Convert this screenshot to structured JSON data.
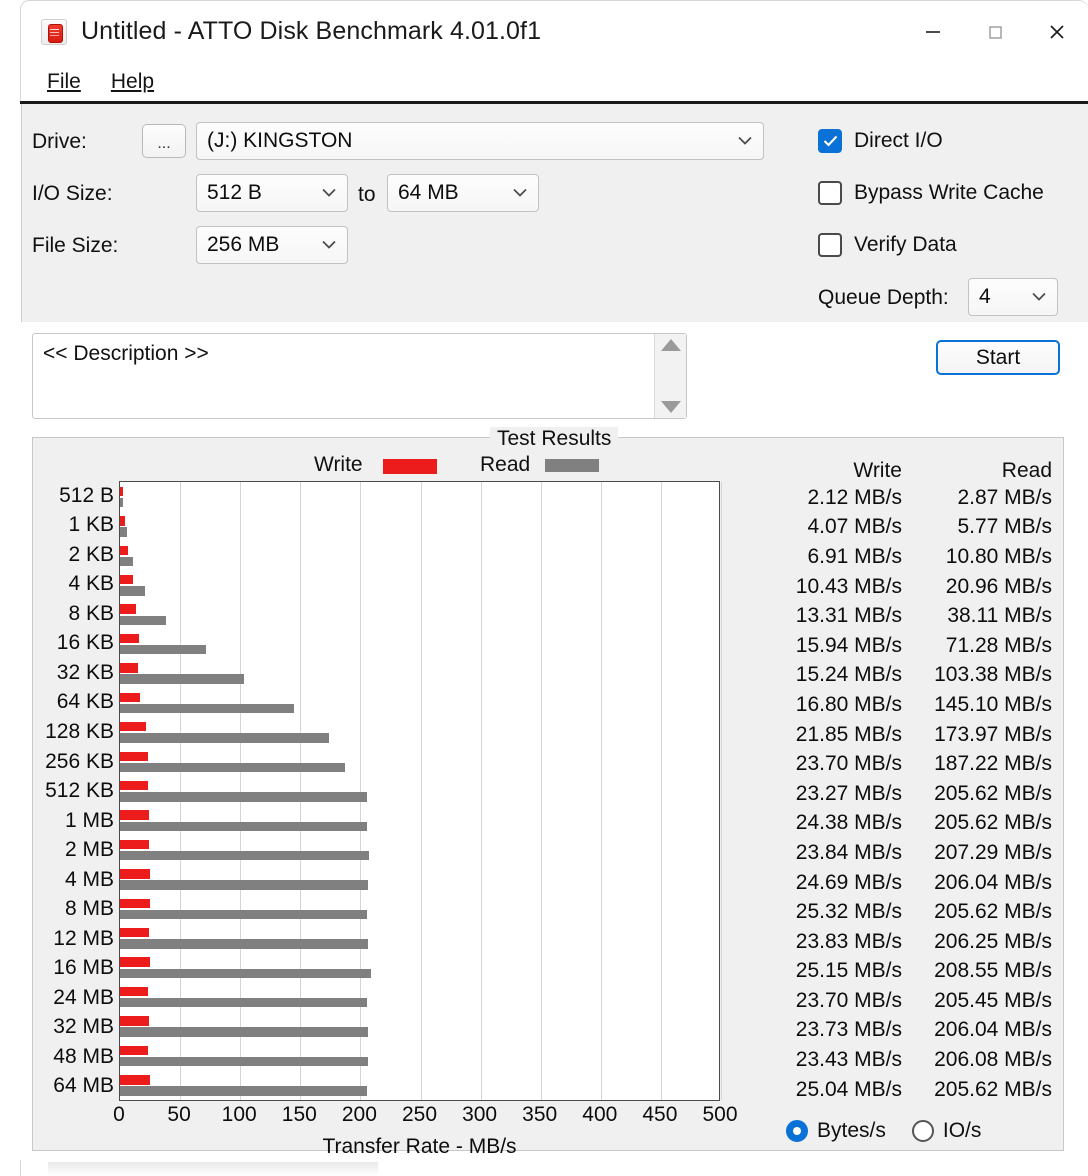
{
  "window": {
    "title": "Untitled - ATTO Disk Benchmark 4.01.0f1",
    "app_icon": "disk-icon",
    "minimize_label": "—",
    "maximize_label": "□",
    "close_label": "✕"
  },
  "menu": {
    "items": [
      {
        "label": "File",
        "mnemonic": "F"
      },
      {
        "label": "Help",
        "mnemonic": "H"
      }
    ]
  },
  "settings": {
    "drive_label": "Drive:",
    "browse_button": "...",
    "drive_value": "(J:) KINGSTON",
    "io_size_label": "I/O Size:",
    "io_size_min": "512 B",
    "io_size_to": "to",
    "io_size_max": "64 MB",
    "file_size_label": "File Size:",
    "file_size_value": "256 MB",
    "direct_io_label": "Direct I/O",
    "direct_io_checked": true,
    "bypass_cache_label": "Bypass Write Cache",
    "bypass_cache_checked": false,
    "verify_data_label": "Verify Data",
    "verify_data_checked": false,
    "queue_depth_label": "Queue Depth:",
    "queue_depth_value": "4",
    "start_button": "Start"
  },
  "description": {
    "text": "<< Description >>"
  },
  "results": {
    "group_title": "Test Results",
    "legend": {
      "write": "Write",
      "read": "Read"
    },
    "table_headers": {
      "write": "Write",
      "read": "Read"
    },
    "units": {
      "bytes_per_sec": "Bytes/s",
      "io_per_sec": "IO/s",
      "selected": "Bytes/s"
    }
  },
  "colors": {
    "write": "#ED1C1C",
    "read": "#808080",
    "accent": "#0a72d6",
    "panel": "#f0f0f0"
  },
  "chart_data": {
    "type": "bar",
    "title": "Test Results",
    "xlabel": "Transfer Rate - MB/s",
    "ylabel": "",
    "orientation": "horizontal",
    "xlim": [
      0,
      500
    ],
    "xticks": [
      0,
      50,
      100,
      150,
      200,
      250,
      300,
      350,
      400,
      450,
      500
    ],
    "grid": true,
    "legend_position": "top",
    "categories": [
      "512 B",
      "1 KB",
      "2 KB",
      "4 KB",
      "8 KB",
      "16 KB",
      "32 KB",
      "64 KB",
      "128 KB",
      "256 KB",
      "512 KB",
      "1 MB",
      "2 MB",
      "4 MB",
      "8 MB",
      "12 MB",
      "16 MB",
      "24 MB",
      "32 MB",
      "48 MB",
      "64 MB"
    ],
    "series": [
      {
        "name": "Write",
        "color": "#ED1C1C",
        "unit": "MB/s",
        "values": [
          2.12,
          4.07,
          6.91,
          10.43,
          13.31,
          15.94,
          15.24,
          16.8,
          21.85,
          23.7,
          23.27,
          24.38,
          23.84,
          24.69,
          25.32,
          23.83,
          25.15,
          23.7,
          23.73,
          23.43,
          25.04
        ]
      },
      {
        "name": "Read",
        "color": "#808080",
        "unit": "MB/s",
        "values": [
          2.87,
          5.77,
          10.8,
          20.96,
          38.11,
          71.28,
          103.38,
          145.1,
          173.97,
          187.22,
          205.62,
          205.62,
          207.29,
          206.04,
          205.62,
          206.25,
          208.55,
          205.45,
          206.04,
          206.08,
          205.62
        ]
      }
    ],
    "value_labels": {
      "write": [
        "2.12 MB/s",
        "4.07 MB/s",
        "6.91 MB/s",
        "10.43 MB/s",
        "13.31 MB/s",
        "15.94 MB/s",
        "15.24 MB/s",
        "16.80 MB/s",
        "21.85 MB/s",
        "23.70 MB/s",
        "23.27 MB/s",
        "24.38 MB/s",
        "23.84 MB/s",
        "24.69 MB/s",
        "25.32 MB/s",
        "23.83 MB/s",
        "25.15 MB/s",
        "23.70 MB/s",
        "23.73 MB/s",
        "23.43 MB/s",
        "25.04 MB/s"
      ],
      "read": [
        "2.87 MB/s",
        "5.77 MB/s",
        "10.80 MB/s",
        "20.96 MB/s",
        "38.11 MB/s",
        "71.28 MB/s",
        "103.38 MB/s",
        "145.10 MB/s",
        "173.97 MB/s",
        "187.22 MB/s",
        "205.62 MB/s",
        "205.62 MB/s",
        "207.29 MB/s",
        "206.04 MB/s",
        "205.62 MB/s",
        "206.25 MB/s",
        "208.55 MB/s",
        "205.45 MB/s",
        "206.04 MB/s",
        "206.08 MB/s",
        "205.62 MB/s"
      ]
    }
  }
}
